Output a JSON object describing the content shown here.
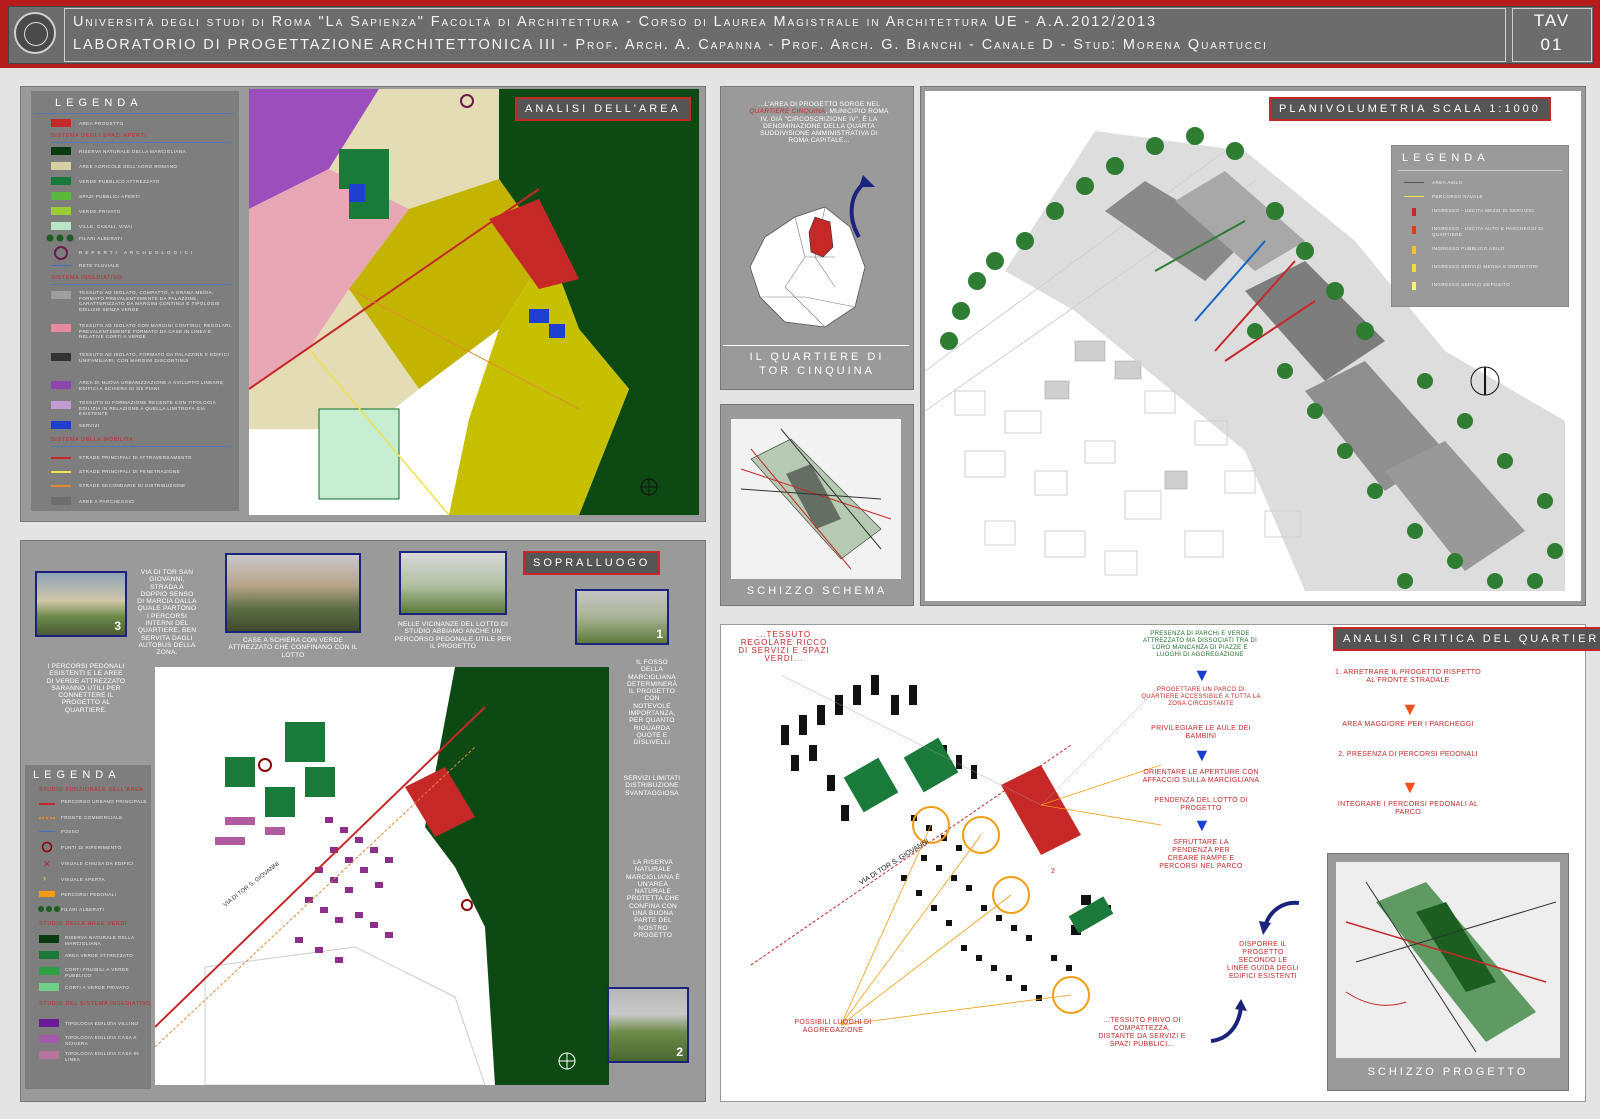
{
  "header": {
    "line1": "Università degli studi di Roma \"La Sapienza\" Facoltà di Architettura - Corso di Laurea Magistrale in Architettura UE - A.A.2012/2013",
    "line2": "LABORATORIO DI PROGETTAZIONE ARCHITETTONICA III - Prof. Arch. A. Capanna - Prof. Arch. G. Bianchi - Canale D - Stud: Morena Quartucci",
    "tav_label": "TAV",
    "tav_number": "01"
  },
  "analisi": {
    "tag": "ANALISI DELL'AREA",
    "legend_title": "LEGENDA",
    "area_progetto": "AREA PROGETTO",
    "sec_spazi": "SISTEMA DEGLI SPAZI APERTI",
    "spazi_items": [
      "RISERVA NATURALE DELLA MARCIGLIANA",
      "AREE AGRICOLE DELL'AGRO ROMANO",
      "VERDE PUBBLICO ATTREZZATO",
      "SPAZI PUBBLICI APERTI",
      "VERDE PRIVATO",
      "VILLE, CASALI, VIVAI"
    ],
    "filari": "FILARI ALBERATI",
    "reperti": "REPERTI ARCHEOLOGICI",
    "rete": "RETE FLUVIALE",
    "sec_insediativo": "SISTEMA INSEDIATIVO",
    "insediativo_items": [
      "TESSUTO AD ISOLATO, COMPATTO, A GRANA MEDIA, FORMATO PREVALENTEMENTE DA PALAZZINE, CARATTERIZZATO DA MARGINI CONTINUI E TIPOLOGIE EDILIZIE SENZA VERDE",
      "TESSUTO AD ISOLATO CON MARGINI CONTINUI, REGOLARI, PREVALENTEMENTE FORMATO DA CASE IN LINEA E RELATIVE CORTI A VERDE",
      "TESSUTO AD ISOLATO, FORMATO DA PALAZZINE E EDIFICI UNIFAMILIARI, CON MARGINI DISCONTINUI",
      "AREA DI NUOVA URBANIZZAZIONE A SVILUPPO LINEARE, EDIFICI A SCHIERA DI 3/5 PIANI",
      "TESSUTO DI FORMAZIONE RECENTE CON TIPOLOGIA EDILIZIA IN RELAZIONE A QUELLA LIMITROFA GIÀ ESISTENTE",
      "SERVIZI"
    ],
    "sec_mobilita": "SISTEMA DELLA MOBILITA'",
    "mobilita_items": [
      "STRADE PRINCIPALI DI ATTRAVERSAMENTO",
      "STRADE PRINCIPALI DI PENETRAZIONE",
      "STRADE SECONDARIE DI DISTRIBUZIONE",
      "AREE A PARCHEGGIO"
    ]
  },
  "quartiere": {
    "note_prefix": "...L'AREA DI PROGETTO SORGE NEL",
    "note_highlight": "QUARTIERE CINQUINA",
    "note_suffix": ", MUNICIPIO ROMA IV, GIÀ \"CIRCOSCRIZIONE IV\", È LA DENOMINAZIONE DELLA QUARTA SUDDIVISIONE AMMINISTRATIVA DI ROMA CAPITALE...",
    "caption_line1": "IL QUARTIERE DI",
    "caption_line2": "TOR CINQUINA"
  },
  "schizzo_schema": {
    "caption": "SCHIZZO SCHEMA"
  },
  "planivolumetria": {
    "tag": "PLANIVOLUMETRIA SCALA 1:1000",
    "legend_title": "LEGENDA",
    "legend_items": [
      "AREA ASILO",
      "PERCORSO NAVALE",
      "INGRESSO - USCITA MEZZI DI SERVIZIO",
      "INGRESSO - USCITA AUTO E PARCHEGGI DI QUARTIERE",
      "INGRESSO PUBBLICO ASILO",
      "INGRESSO SERVIZI MENSA E DORMITORI",
      "INGRESSO SERVIZI DEPOSITO"
    ]
  },
  "sopralluogo": {
    "tag": "SOPRALLUOGO",
    "note_via": "VIA DI TOR SAN GIOVANNI, STRADA A DOPPIO SENSO DI MARCIA DALLA QUALE PARTONO I PERCORSI INTERNI DEL QUARTIERE, BEN SERVITA DAGLI AUTOBUS DELLA ZONA.",
    "note_case": "CASE A SCHIERA CON VERDE ATTREZZATO CHE CONFINANO CON IL LOTTO",
    "note_vicinanze": "NELLE VICINANZE DEL LOTTO DI STUDIO ABBIAMO ANCHE UN PERCORSO PEDONALE UTILE PER IL PROGETTO",
    "note_percorsi": "I PERCORSI PEDONALI ESISTENTI E LE AREE DI VERDE ATTREZZATO SARANNO UTILI PER CONNETTERE IL PROGETTO AL QUARTIERE.",
    "note_fosso": "IL FOSSO DELLA MARCIGLIANA DETERMINERÀ IL PROGETTO CON NOTEVOLE IMPORTANZA, PER QUANTO RIGUARDA QUOTE E DISLIVELLI",
    "note_servizi": "SERVIZI LIMITATI DISTRIBUZIONE SVANTAGGIOSA",
    "note_riserva": "LA RISERVA NATURALE MARCIGLIANA È UN'AREA NATURALE PROTETTA CHE CONFINA CON UNA BUONA PARTE DEL NOSTRO PROGETTO",
    "street_label": "VIA DI TOR S. GIOVANNI",
    "photo1_num": "1",
    "photo2_num": "2",
    "photo3_num": "3",
    "legend_title": "LEGENDA",
    "sec_funzionale": "STUDIO FUNZIONALE DELL'AREA",
    "funz_items": [
      "PERCORSO URBANO PRINCIPALE",
      "FRONTE COMMERCIALE",
      "FOSSO",
      "PUNTI DI RIFERIMENTO",
      "VISUALE CHIUSA DA EDIFICI",
      "VISUALE APERTA",
      "PERCORSI PEDONALI",
      "FILARI ALBERATI"
    ],
    "sec_verdi": "STUDIO DELLE AREE VERDI",
    "verdi_items": [
      "RISERVA NATURALE DELLA MARCIGLIANA",
      "AREA VERDE ATTREZZATO",
      "CORTI FRUIBILI A VERDE PUBBLICO",
      "CORTI A VERDE PRIVATO"
    ],
    "sec_insed": "STUDIO DEL SISTEMA INSEDIATIVO",
    "insed_items": [
      "TIPOLOGIA EDILIZIA VILLINO",
      "TIPOLOGIA EDILIZIA CASA A SCHIERA",
      "TIPOLOGIA EDILIZIA CASA IN LINEA"
    ]
  },
  "critica": {
    "tag": "ANALISI CRITICA DEL QUARTIERE",
    "note_tessuto": "...TESSUTO REGOLARE RICCO DI SERVIZI E SPAZI VERDI...",
    "note_presenza": "PRESENZA DI PARCHI E VERDE ATTREZZATO MA DISSOCIATI TRA DI LORO MANCANZA DI PIAZZE E LUOGHI DI AGGREGAZIONE",
    "note_progettare": "PROGETTARE UN PARCO DI QUARTIERE ACCESSIBILE A TUTTA LA ZONA CIRCOSTANTE",
    "note_privilegiare": "PRIVILEGIARE LE AULE DEI BAMBINI",
    "note_orientare": "ORIENTARE LE APERTURE CON AFFACCIO SULLA MARCIGLIANA",
    "note_pendenza": "PENDENZA DEL LOTTO DI PROGETTO",
    "note_sfruttare": "SFRUTTARE LA PENDENZA PER CREARE RAMPE E PERCORSI NEL PARCO",
    "note_arretrare": "1. ARRETRARE IL PROGETTO RISPETTO AL FRONTE STRADALE",
    "note_area": "AREA MAGGIORE PER I PARCHEGGI",
    "note_presenza_percorsi": "2. PRESENZA DI PERCORSI PEDONALI",
    "note_integrare": "INTEGRARE I PERCORSI PEDONALI AL PARCO",
    "note_disporre": "DISPORRE IL PROGETTO SECONDO LE LINEE GUIDA DEGLI EDIFICI ESISTENTI",
    "note_possibili": "POSSIBILI LUOGHI DI AGGREGAZIONE",
    "note_privo": "...TESSUTO PRIVO DI COMPATTEZZA, DISTANTE DA SERVIZI E SPAZI PUBBLICI...",
    "street_label": "VIA DI TOR S. GIOVANNI",
    "label_1": "1",
    "label_2": "2",
    "schizzo_caption": "SCHIZZO PROGETTO"
  }
}
